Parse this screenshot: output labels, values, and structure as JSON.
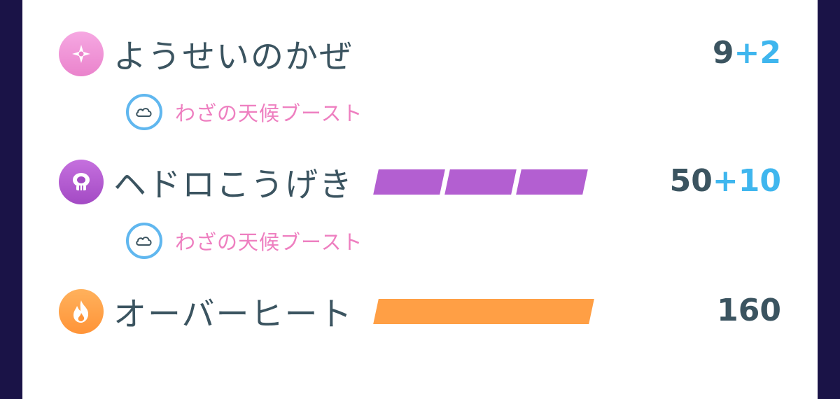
{
  "moves": [
    {
      "name": "ようせいのかぜ",
      "type_icon": "fairy-icon",
      "type_color": "#f092d6",
      "power_base": "9",
      "power_bonus": "+2",
      "energy_bars": 0,
      "weather_boost": true
    },
    {
      "name": "ヘドロこうげき",
      "type_icon": "poison-icon",
      "type_color": "#b35fd1",
      "power_base": "50",
      "power_bonus": "+10",
      "energy_bars": 3,
      "energy_bar_color": "#b35fd1",
      "weather_boost": true
    },
    {
      "name": "オーバーヒート",
      "type_icon": "fire-icon",
      "type_color": "#ff9f45",
      "power_base": "160",
      "power_bonus": "",
      "energy_bars": 1,
      "energy_bar_color": "#ff9f45",
      "weather_boost": false
    }
  ],
  "boost_label": "わざの天候ブースト",
  "boost_icon": "cloud-icon",
  "colors": {
    "bonus": "#3fb6ee",
    "boost_ring": "#60b7ef",
    "boost_text": "#ee7fc0"
  }
}
